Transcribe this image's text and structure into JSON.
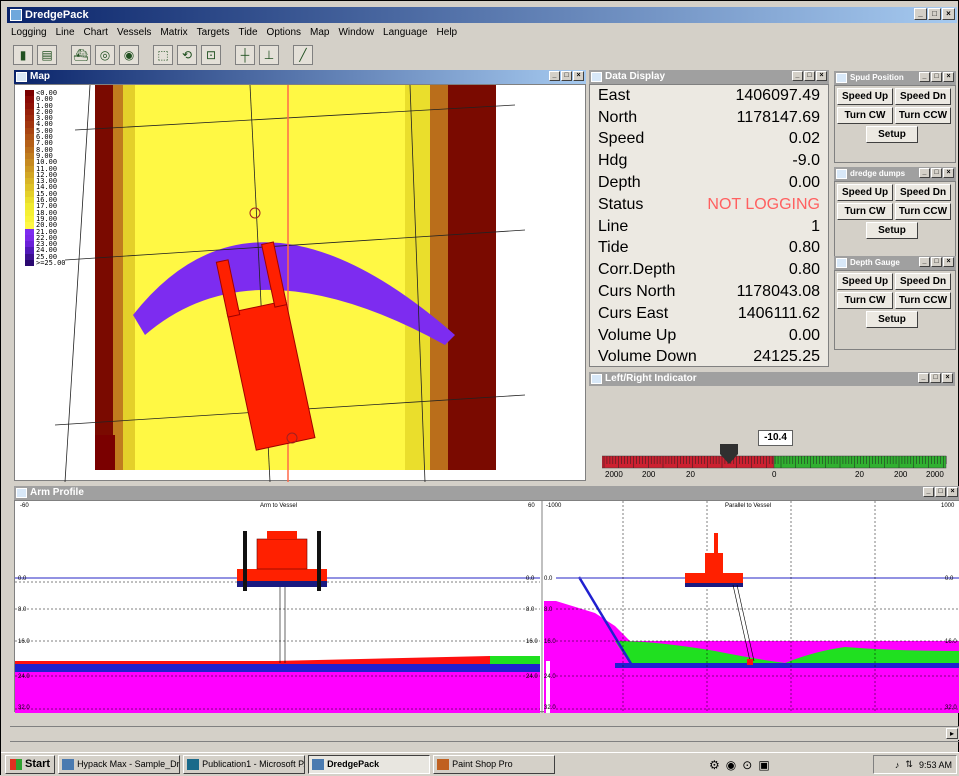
{
  "app": {
    "title": "DredgePack"
  },
  "menu": [
    "Logging",
    "Line",
    "Chart",
    "Vessels",
    "Matrix",
    "Targets",
    "Tide",
    "Options",
    "Map",
    "Window",
    "Language",
    "Help"
  ],
  "toolbar_icons": [
    "open-icon",
    "save-icon",
    "vessel-icon",
    "target-icon",
    "zoom-icon",
    "pan-icon",
    "rotate-icon",
    "measure-icon",
    "grid-icon",
    "ruler-icon",
    "pen-icon"
  ],
  "map": {
    "title": "Map",
    "legend": [
      {
        "label": "<0.00",
        "color": "#7a0000"
      },
      {
        "label": "0.00",
        "color": "#8a0a05"
      },
      {
        "label": "1.00",
        "color": "#8f1307"
      },
      {
        "label": "2.00",
        "color": "#96200a"
      },
      {
        "label": "3.00",
        "color": "#9c2a0c"
      },
      {
        "label": "4.00",
        "color": "#a2360f"
      },
      {
        "label": "5.00",
        "color": "#a84412"
      },
      {
        "label": "6.00",
        "color": "#ae5215"
      },
      {
        "label": "7.00",
        "color": "#b46018"
      },
      {
        "label": "8.00",
        "color": "#ba6e1b"
      },
      {
        "label": "9.00",
        "color": "#c07c1e"
      },
      {
        "label": "10.00",
        "color": "#c68a20"
      },
      {
        "label": "11.00",
        "color": "#cc9822"
      },
      {
        "label": "12.00",
        "color": "#d2a624"
      },
      {
        "label": "13.00",
        "color": "#d8b426"
      },
      {
        "label": "14.00",
        "color": "#dec228"
      },
      {
        "label": "15.00",
        "color": "#e4d02a"
      },
      {
        "label": "16.00",
        "color": "#eade2c"
      },
      {
        "label": "17.00",
        "color": "#f0ea30"
      },
      {
        "label": "18.00",
        "color": "#f6f034"
      },
      {
        "label": "19.00",
        "color": "#faf43a"
      },
      {
        "label": "20.00",
        "color": "#fff844"
      },
      {
        "label": "21.00",
        "color": "#7d2cf0"
      },
      {
        "label": "22.00",
        "color": "#7a28e8"
      },
      {
        "label": "23.00",
        "color": "#6a20d8"
      },
      {
        "label": "24.00",
        "color": "#5018b8"
      },
      {
        "label": "25.00",
        "color": "#3c1090"
      },
      {
        "label": ">=25.00",
        "color": "#2a0870"
      }
    ]
  },
  "data_display": {
    "title": "Data Display",
    "rows": [
      {
        "label": "East",
        "value": "1406097.49"
      },
      {
        "label": "North",
        "value": "1178147.69"
      },
      {
        "label": "Speed",
        "value": "0.02"
      },
      {
        "label": "Hdg",
        "value": "-9.0"
      },
      {
        "label": "Depth",
        "value": "0.00"
      },
      {
        "label": "Status",
        "value": "NOT LOGGING"
      },
      {
        "label": "Line",
        "value": "1"
      },
      {
        "label": "Tide",
        "value": "0.80"
      },
      {
        "label": "Corr.Depth",
        "value": "0.80"
      },
      {
        "label": "Curs North",
        "value": "1178043.08"
      },
      {
        "label": "Curs East",
        "value": "1406111.62"
      },
      {
        "label": "Volume Up",
        "value": "0.00"
      },
      {
        "label": "Volume Down",
        "value": "24125.25"
      }
    ]
  },
  "panels": [
    {
      "title": "Spud Position",
      "speed_up": "Speed Up",
      "speed_dn": "Speed Dn",
      "turn_cw": "Turn CW",
      "turn_ccw": "Turn CCW",
      "setup": "Setup"
    },
    {
      "title": "dredge dumps",
      "speed_up": "Speed Up",
      "speed_dn": "Speed Dn",
      "turn_cw": "Turn CW",
      "turn_ccw": "Turn CCW",
      "setup": "Setup"
    },
    {
      "title": "Depth Gauge",
      "speed_up": "Speed Up",
      "speed_dn": "Speed Dn",
      "turn_cw": "Turn CW",
      "turn_ccw": "Turn CCW",
      "setup": "Setup"
    }
  ],
  "lr_indicator": {
    "title": "Left/Right Indicator",
    "value": "-10.4",
    "ticks": [
      "2000",
      "200",
      "20",
      "0",
      "20",
      "200",
      "2000"
    ],
    "colors": {
      "left": "#cc2030",
      "right": "#30b030"
    }
  },
  "arm_profile": {
    "title": "Arm Profile",
    "left": {
      "title": "Arm to Vessel",
      "xmin": "-60",
      "xmax": "60",
      "depth_labels": [
        "0.0",
        "8.0",
        "16.0",
        "24.0",
        "32.0"
      ]
    },
    "right": {
      "title": "Parallel to Vessel",
      "xmin": "-1000",
      "xmax": "1000",
      "depth_labels": [
        "0.0",
        "8.0",
        "16.0",
        "24.0",
        "32.0"
      ]
    }
  },
  "taskbar": {
    "start": "Start",
    "tasks": [
      "Hypack Max - Sample_Dr...",
      "Publication1 - Microsoft P...",
      "DredgePack",
      "Paint Shop Pro"
    ],
    "time": "9:53 AM"
  },
  "colors": {
    "title_active": "#0a246a",
    "magenta": "#ff00ff",
    "green": "#20e020",
    "vessel_red": "#ff2000",
    "cut_purple": "#7d2cf0"
  }
}
